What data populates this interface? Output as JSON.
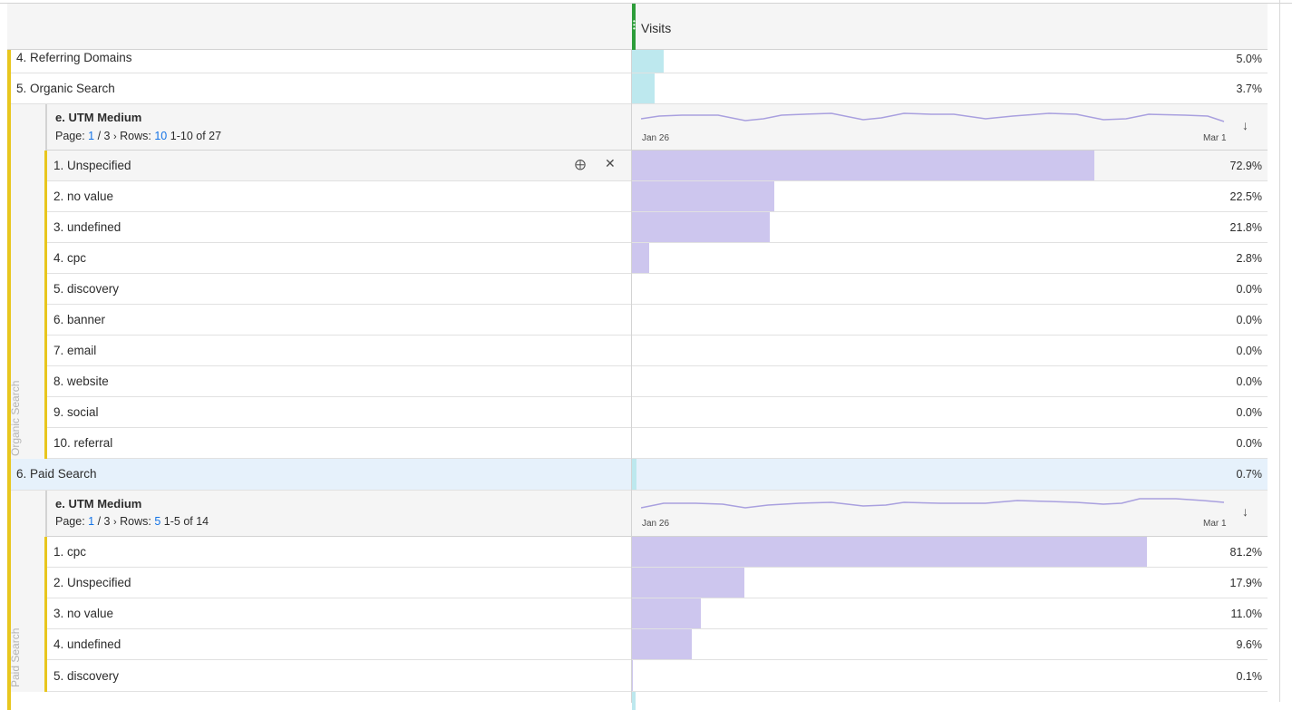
{
  "header": {
    "metric": "Visits"
  },
  "top_rows": [
    {
      "label": "4.  Referring Domains",
      "pct": "5.0%",
      "fraction": 0.05
    },
    {
      "label": "5.  Organic Search",
      "pct": "3.7%",
      "fraction": 0.037
    }
  ],
  "organic_breakdown": {
    "side_label": "Organic Search",
    "title": "e. UTM Medium",
    "page_label": "Page:",
    "page_current": "1",
    "page_total": "/ 3",
    "rows_label": "Rows:",
    "rows_value": "10",
    "range": "1-10 of 27",
    "spark_start": "Jan 26",
    "spark_end": "Mar 1",
    "rows": [
      {
        "label": "1.  Unspecified",
        "pct": "72.9%",
        "fraction": 0.729
      },
      {
        "label": "2.  no value",
        "pct": "22.5%",
        "fraction": 0.225
      },
      {
        "label": "3.  undefined",
        "pct": "21.8%",
        "fraction": 0.218
      },
      {
        "label": "4.  cpc",
        "pct": "2.8%",
        "fraction": 0.028
      },
      {
        "label": "5.  discovery",
        "pct": "0.0%",
        "fraction": 0
      },
      {
        "label": "6.  banner",
        "pct": "0.0%",
        "fraction": 0
      },
      {
        "label": "7.  email",
        "pct": "0.0%",
        "fraction": 0
      },
      {
        "label": "8.  website",
        "pct": "0.0%",
        "fraction": 0
      },
      {
        "label": "9.  social",
        "pct": "0.0%",
        "fraction": 0
      },
      {
        "label": "10.  referral",
        "pct": "0.0%",
        "fraction": 0
      }
    ]
  },
  "paid_row": {
    "label": "6.  Paid Search",
    "pct": "0.7%",
    "fraction": 0.007
  },
  "paid_breakdown": {
    "side_label": "Paid Search",
    "title": "e. UTM Medium",
    "page_label": "Page:",
    "page_current": "1",
    "page_total": "/ 3",
    "rows_label": "Rows:",
    "rows_value": "5",
    "range": "1-5 of 14",
    "spark_start": "Jan 26",
    "spark_end": "Mar 1",
    "rows": [
      {
        "label": "1.  cpc",
        "pct": "81.2%",
        "fraction": 0.812
      },
      {
        "label": "2.  Unspecified",
        "pct": "17.9%",
        "fraction": 0.179
      },
      {
        "label": "3.  no value",
        "pct": "11.0%",
        "fraction": 0.11
      },
      {
        "label": "4.  undefined",
        "pct": "9.6%",
        "fraction": 0.096
      },
      {
        "label": "5.  discovery",
        "pct": "0.1%",
        "fraction": 0.001
      }
    ]
  },
  "colors": {
    "accent_green": "#2d9d3a",
    "bar_blue": "#bde8ee",
    "bar_purple": "#cdc6ee",
    "row_highlight": "#e6f1fb",
    "segment_yellow": "#e8c61e"
  }
}
